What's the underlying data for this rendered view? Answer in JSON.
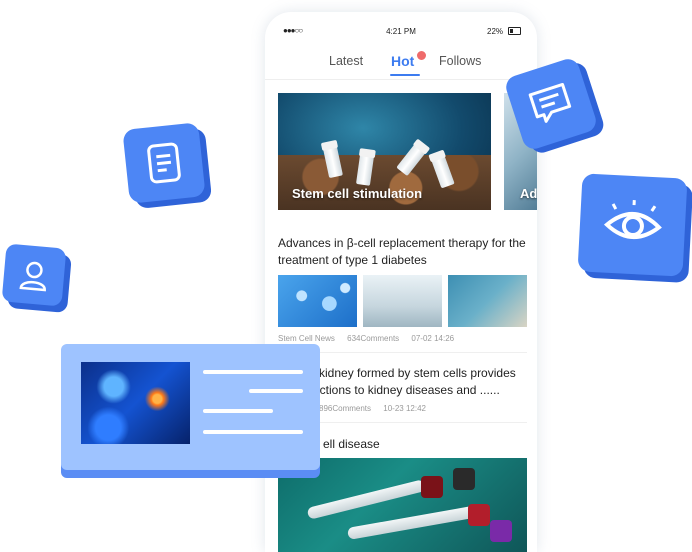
{
  "status_bar": {
    "signal": "●●●○○",
    "time": "4:21 PM",
    "battery_percent": "22%"
  },
  "tabs": [
    {
      "label": "Latest"
    },
    {
      "label": "Hot",
      "active": true
    },
    {
      "label": "Follows"
    }
  ],
  "banners": [
    {
      "title": "Stem cell stimulation"
    },
    {
      "title": "Adv"
    }
  ],
  "articles": [
    {
      "title": "Advances in β-cell replacement therapy for the treatment of type 1 diabetes",
      "source": "Stem Cell News",
      "comments": "634Comments",
      "date": "07-02 14:26"
    },
    {
      "title": "i kidney formed by stem cells provides ections to kidney diseases and ......",
      "comments": "896Comments",
      "date": "10-23 12:42"
    },
    {
      "title": "ell disease"
    }
  ],
  "icons": {
    "floating": [
      "document-icon",
      "user-icon",
      "chat-icon",
      "eye-icon"
    ]
  },
  "colors": {
    "accent": "#3d7cf0",
    "float_icon": "#4d86f5",
    "hot_badge": "#ef6b6b"
  }
}
